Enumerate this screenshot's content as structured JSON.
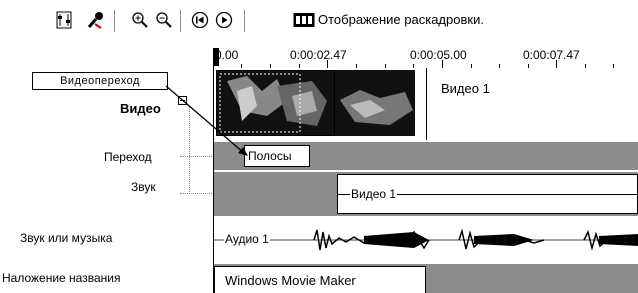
{
  "toolbar": {
    "storyboard_label": "Отображение раскадровки."
  },
  "ruler": {
    "ticks": [
      "0.00",
      "0:00:02.47",
      "0:00:05.00",
      "0:00:07.47"
    ]
  },
  "callout": {
    "label": "Видеопереход"
  },
  "tracks": {
    "video": "Видео",
    "transition": "Переход",
    "audio": "Звук",
    "audio_music": "Звук или музыка",
    "title_overlay": "Наложение названия"
  },
  "clips": {
    "video_clip_label": "Видео 1",
    "transition_label": "Полосы",
    "audio_clip_label": "Видео 1",
    "music_clip_label": "Аудио 1",
    "title_clip_label": "Windows Movie Maker"
  },
  "colors": {
    "band_gray": "#8c8c8c",
    "border": "#000000"
  }
}
